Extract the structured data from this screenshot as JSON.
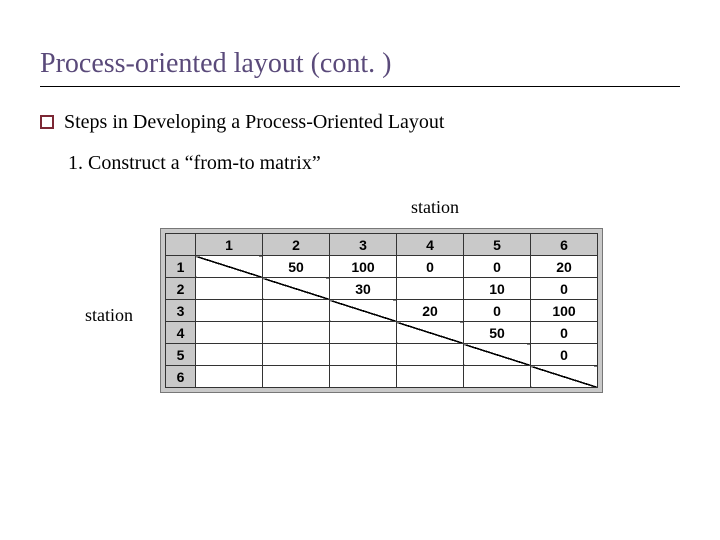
{
  "title": "Process-oriented layout (cont. )",
  "bullet": "Steps in Developing a Process-Oriented Layout",
  "step1": "1. Construct a “from-to matrix”",
  "labels": {
    "station_top": "station",
    "station_left": "station"
  },
  "chart_data": {
    "type": "table",
    "title": "from-to matrix",
    "col_headers": [
      "1",
      "2",
      "3",
      "4",
      "5",
      "6"
    ],
    "row_headers": [
      "1",
      "2",
      "3",
      "4",
      "5",
      "6"
    ],
    "cells": {
      "r1": {
        "c2": "50",
        "c3": "100",
        "c4": "0",
        "c5": "0",
        "c6": "20"
      },
      "r2": {
        "c3": "30",
        "c4": "",
        "c5": "10",
        "c6": "0"
      },
      "r3": {
        "c4": "20",
        "c5": "0",
        "c6": "100"
      },
      "r4": {
        "c5": "50",
        "c6": "0"
      },
      "r5": {
        "c6": "0"
      }
    }
  }
}
